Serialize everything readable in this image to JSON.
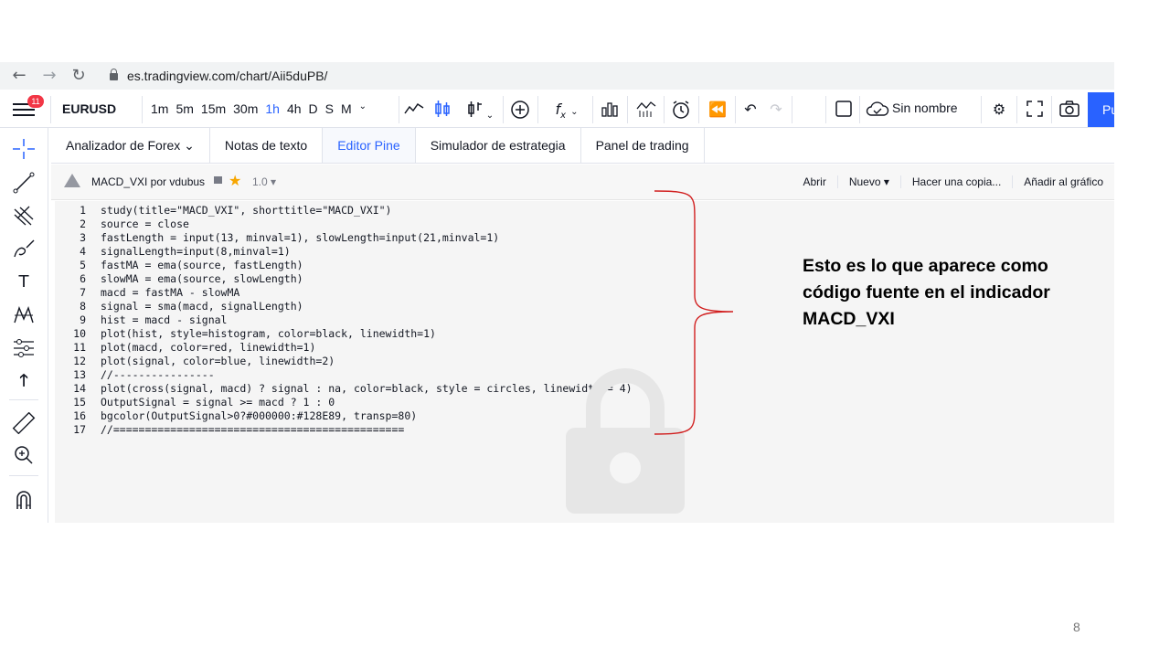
{
  "browser": {
    "url": "es.tradingview.com/chart/Aii5duPB/",
    "back_icon": "←",
    "forward_icon": "→",
    "reload_icon": "↻"
  },
  "toolbar": {
    "notification_count": "11",
    "symbol": "EURUSD",
    "intervals": [
      "1m",
      "5m",
      "15m",
      "30m",
      "1h",
      "4h",
      "D",
      "S",
      "M"
    ],
    "active_interval": "1h",
    "layout_name": "Sin nombre",
    "publish_label": "Pu"
  },
  "tabs": [
    {
      "label": "Analizador de Forex ⌄",
      "active": false
    },
    {
      "label": "Notas de texto",
      "active": false
    },
    {
      "label": "Editor Pine",
      "active": true
    },
    {
      "label": "Simulador de estrategia",
      "active": false
    },
    {
      "label": "Panel de trading",
      "active": false
    }
  ],
  "editor_header": {
    "script_name": "MACD_VXI por vdubus",
    "version": "1.0 ▾",
    "actions": [
      "Abrir",
      "Nuevo ▾",
      "Hacer una copia...",
      "Añadir al gráfico"
    ]
  },
  "code_lines": [
    "study(title=\"MACD_VXI\", shorttitle=\"MACD_VXI\")",
    "source = close",
    "fastLength = input(13, minval=1), slowLength=input(21,minval=1)",
    "signalLength=input(8,minval=1)",
    "fastMA = ema(source, fastLength)",
    "slowMA = ema(source, slowLength)",
    "macd = fastMA - slowMA",
    "signal = sma(macd, signalLength)",
    "hist = macd - signal",
    "plot(hist, style=histogram, color=black, linewidth=1)",
    "plot(macd, color=red, linewidth=1)",
    "plot(signal, color=blue, linewidth=2)",
    "//----------------",
    "plot(cross(signal, macd) ? signal : na, color=black, style = circles, linewidth = 4)",
    "OutputSignal = signal >= macd ? 1 : 0",
    "bgcolor(OutputSignal>0?#000000:#128E89, transp=80)",
    "//=============================================="
  ],
  "annotation": {
    "text": "Esto es lo que aparece como código fuente en el indicador MACD_VXI"
  },
  "slide_number": "8",
  "colors": {
    "accent": "#2962ff",
    "badge": "#f23645",
    "brace": "#d11f1f",
    "star": "#f7a600"
  }
}
